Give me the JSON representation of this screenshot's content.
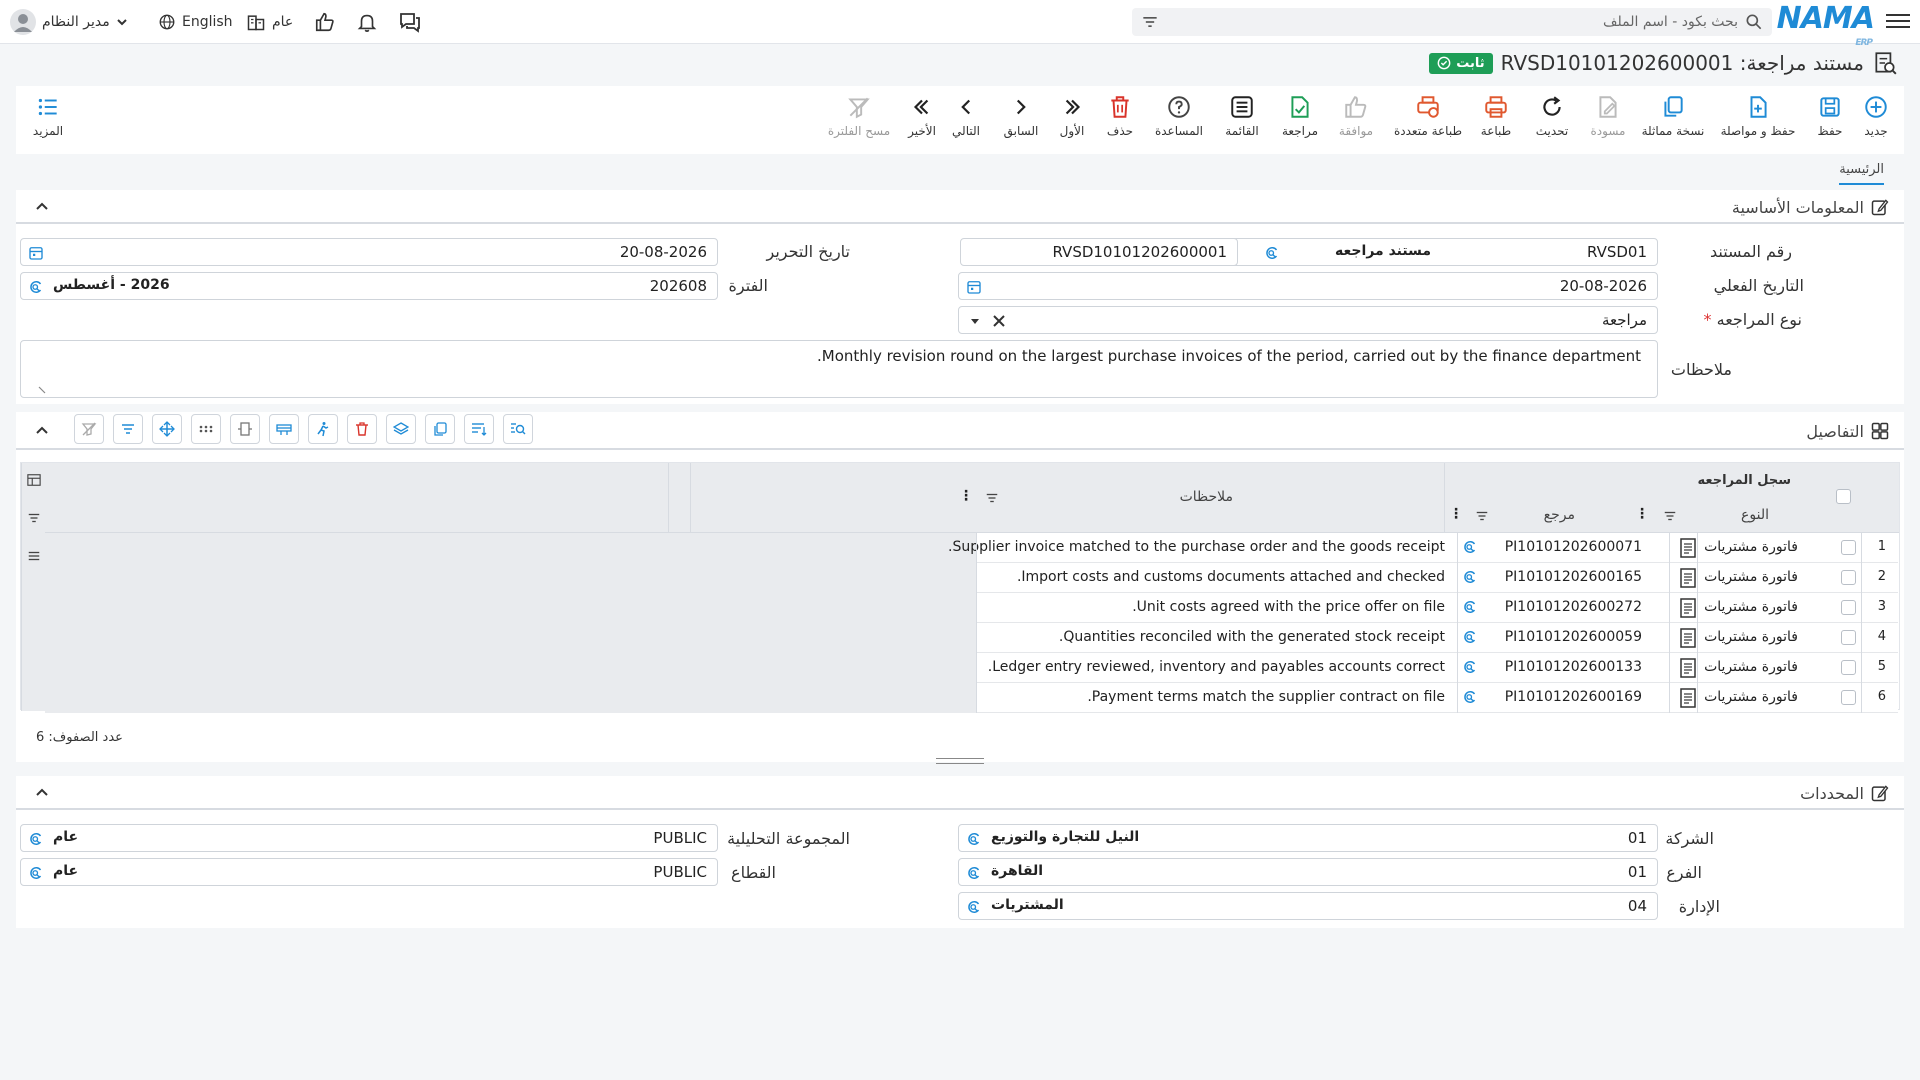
{
  "topbar": {
    "search_placeholder": "بحث بكود - اسم الملف",
    "logo": "NAMA",
    "logo_sub": "ERP",
    "user_name": "مدير النظام",
    "language": "English",
    "scope": "عام"
  },
  "document": {
    "title": "مستند مراجعة: RVSD10101202600001",
    "status": "ثابت",
    "status_color": "#1e9e57"
  },
  "toolbar": [
    {
      "label": "جديد",
      "icon": "plus-circle-icon"
    },
    {
      "label": "حفظ",
      "icon": "save-icon"
    },
    {
      "label": "حفظ و مواصلة",
      "icon": "save-continue-icon"
    },
    {
      "label": "نسخة مماثلة",
      "icon": "duplicate-icon"
    },
    {
      "label": "مسودة",
      "icon": "draft-icon"
    },
    {
      "label": "تحديث",
      "icon": "refresh-icon"
    },
    {
      "label": "طباعة",
      "icon": "print-icon"
    },
    {
      "label": "طباعة متعددة",
      "icon": "multi-print-icon"
    },
    {
      "label": "موافقة",
      "icon": "thumbs-up-icon"
    },
    {
      "label": "مراجعة",
      "icon": "review-icon"
    },
    {
      "label": "القائمة",
      "icon": "list-icon"
    },
    {
      "label": "المساعدة",
      "icon": "help-icon"
    },
    {
      "label": "حذف",
      "icon": "trash-icon"
    },
    {
      "label": "الأول",
      "icon": "first-icon"
    },
    {
      "label": "السابق",
      "icon": "previous-icon"
    },
    {
      "label": "التالي",
      "icon": "next-icon"
    },
    {
      "label": "الأخير",
      "icon": "last-icon"
    },
    {
      "label": "مسح الفلترة",
      "icon": "clear-filter-icon"
    }
  ],
  "more_label": "المزيد",
  "tabs": {
    "main": "الرئيسية"
  },
  "basic_info": {
    "title": "المعلومات الأساسية",
    "doc_number_label": "رقم المستند",
    "doc_number": "RVSD01",
    "doc_type": "مستند مراجعه",
    "doc_code": "RVSD10101202600001",
    "edit_date_label": "تاريخ التحرير",
    "edit_date": "20-08-2026",
    "actual_date_label": "التاريخ الفعلي",
    "actual_date": "20-08-2026",
    "period_label": "الفترة",
    "period_code": "202608",
    "period_name": "2026 - أغسطس",
    "review_type_label": "نوع المراجعه",
    "review_type": "مراجعة",
    "notes_label": "ملاحظات",
    "notes": "Monthly revision round on the largest purchase invoices of the period, carried out by the finance department."
  },
  "details": {
    "title": "التفاصيل",
    "group_header": "سجل المراجعه",
    "col_type": "النوع",
    "col_ref": "مرجع",
    "col_notes": "ملاحظات",
    "rows": [
      {
        "num": "1",
        "type": "فاتورة مشتريات",
        "ref": "PI10101202600071",
        "note": "Supplier invoice matched to the purchase order and the goods receipt."
      },
      {
        "num": "2",
        "type": "فاتورة مشتريات",
        "ref": "PI10101202600165",
        "note": "Import costs and customs documents attached and checked."
      },
      {
        "num": "3",
        "type": "فاتورة مشتريات",
        "ref": "PI10101202600272",
        "note": "Unit costs agreed with the price offer on file."
      },
      {
        "num": "4",
        "type": "فاتورة مشتريات",
        "ref": "PI10101202600059",
        "note": "Quantities reconciled with the generated stock receipt."
      },
      {
        "num": "5",
        "type": "فاتورة مشتريات",
        "ref": "PI10101202600133",
        "note": "Ledger entry reviewed, inventory and payables accounts correct."
      },
      {
        "num": "6",
        "type": "فاتورة مشتريات",
        "ref": "PI10101202600169",
        "note": "Payment terms match the supplier contract on file."
      }
    ],
    "row_count": "عدد الصفوف: 6"
  },
  "dimensions": {
    "title": "المحددات",
    "company_label": "الشركة",
    "company_code": "01",
    "company_name": "النيل للتجارة والتوزيع",
    "branch_label": "الفرع",
    "branch_code": "01",
    "branch_name": "القاهرة",
    "dept_label": "الإدارة",
    "dept_code": "04",
    "dept_name": "المشتريات",
    "analysis_label": "المجموعة التحليلية",
    "analysis_code": "PUBLIC",
    "analysis_name": "عام",
    "sector_label": "القطاع",
    "sector_code": "PUBLIC",
    "sector_name": "عام"
  }
}
